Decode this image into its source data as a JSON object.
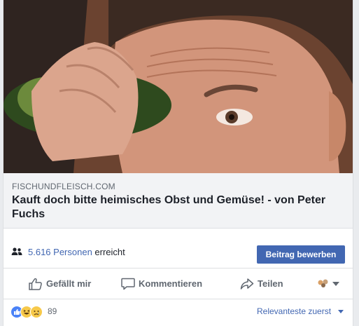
{
  "link_preview": {
    "domain": "FISCHUNDFLEISCH.COM",
    "title": "Kauft doch bitte heimisches Obst und Gemüse! - von Peter Fuchs"
  },
  "reach": {
    "count": "5.616 Personen",
    "suffix": "erreicht",
    "promote_label": "Beitrag bewerben"
  },
  "actions": {
    "like_label": "Gefällt mir",
    "comment_label": "Kommentieren",
    "share_label": "Teilen"
  },
  "reactions": {
    "count": "89",
    "sort_label": "Relevanteste zuerst"
  },
  "colors": {
    "accent": "#4267b2",
    "text": "#1d2129",
    "muted": "#606770"
  },
  "icons": [
    "people-icon",
    "thumbs-up-icon",
    "comment-icon",
    "share-arrow-icon",
    "audience-avatars-icon",
    "chevron-down-icon",
    "like-reaction-icon",
    "haha-reaction-icon",
    "sad-reaction-icon"
  ]
}
